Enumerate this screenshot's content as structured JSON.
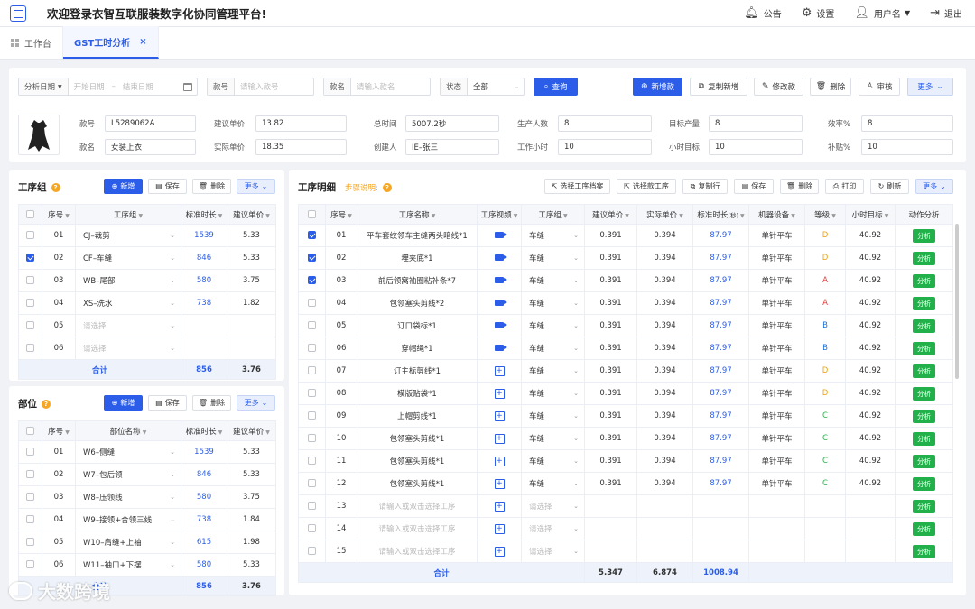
{
  "header": {
    "title": "欢迎登录衣智互联服装数字化协同管理平台!",
    "items": [
      {
        "icon": "bell-icon",
        "label": "公告"
      },
      {
        "icon": "gear-icon",
        "label": "设置"
      },
      {
        "icon": "user-icon",
        "label": "用户名"
      },
      {
        "icon": "logout-icon",
        "label": "退出"
      }
    ]
  },
  "tabs": [
    {
      "label": "工作台"
    },
    {
      "label": "GST工时分析",
      "close": "×"
    }
  ],
  "filters": {
    "date_label": "分析日期",
    "start_ph": "开始日期",
    "sep": "–",
    "end_ph": "结束日期",
    "no_label": "款号",
    "no_ph": "请输入款号",
    "name_label": "款名",
    "name_ph": "请输入款名",
    "status_label": "状态",
    "status_value": "全部",
    "query": "查询"
  },
  "actions": [
    "新增款",
    "复制新增",
    "修改款",
    "删除",
    "审核",
    "更多"
  ],
  "info": [
    {
      "label": "款号",
      "value": "L5289062A"
    },
    {
      "label": "建议单价",
      "value": "13.82"
    },
    {
      "label": "总时间",
      "value": "5007.2秒"
    },
    {
      "label": "生产人数",
      "value": "8"
    },
    {
      "label": "目标产量",
      "value": "8"
    },
    {
      "label": "效率%",
      "value": "8"
    },
    {
      "label": "款名",
      "value": "女装上衣"
    },
    {
      "label": "实际单价",
      "value": "18.35"
    },
    {
      "label": "创建人",
      "value": "IE–张三"
    },
    {
      "label": "工作小时",
      "value": "10"
    },
    {
      "label": "小时目标",
      "value": "10"
    },
    {
      "label": "补贴%",
      "value": "10"
    }
  ],
  "process_group": {
    "title": "工序组",
    "buttons": [
      "新增",
      "保存",
      "删除",
      "更多"
    ],
    "headers": [
      "序号",
      "工序组",
      "标准时长",
      "建议单价"
    ],
    "rows": [
      {
        "checked": false,
        "no": "01",
        "group": "CJ–裁剪",
        "time": "1539",
        "price": "5.33"
      },
      {
        "checked": true,
        "no": "02",
        "group": "CF–车缝",
        "time": "846",
        "price": "5.33"
      },
      {
        "checked": false,
        "no": "03",
        "group": "WB–尾部",
        "time": "580",
        "price": "3.75"
      },
      {
        "checked": false,
        "no": "04",
        "group": "XS–洗水",
        "time": "738",
        "price": "1.82"
      },
      {
        "checked": false,
        "no": "05",
        "group": "请选择",
        "time": "",
        "price": ""
      },
      {
        "checked": false,
        "no": "06",
        "group": "请选择",
        "time": "",
        "price": ""
      }
    ],
    "total": {
      "label": "合计",
      "time": "856",
      "price": "3.76"
    }
  },
  "part": {
    "title": "部位",
    "buttons": [
      "新增",
      "保存",
      "删除",
      "更多"
    ],
    "headers": [
      "序号",
      "部位名称",
      "标准时长",
      "建议单价"
    ],
    "rows": [
      {
        "no": "01",
        "name": "W6–侧缝",
        "time": "1539",
        "price": "5.33"
      },
      {
        "no": "02",
        "name": "W7–包后领",
        "time": "846",
        "price": "5.33"
      },
      {
        "no": "03",
        "name": "W8–压领线",
        "time": "580",
        "price": "3.75"
      },
      {
        "no": "04",
        "name": "W9–接领+合领三线",
        "time": "738",
        "price": "1.84"
      },
      {
        "no": "05",
        "name": "W10–肩缝+上袖",
        "time": "615",
        "price": "1.98"
      },
      {
        "no": "06",
        "name": "W11–袖口+下摆",
        "time": "580",
        "price": "5.33"
      }
    ],
    "total": {
      "label": "合计",
      "time": "856",
      "price": "3.76"
    }
  },
  "detail": {
    "title": "工序明细",
    "note": "步骤说明:",
    "buttons": [
      "选择工序档案",
      "选择款工序",
      "复制行",
      "保存",
      "删除",
      "打印",
      "刷新",
      "更多"
    ],
    "headers": [
      "序号",
      "工序名称",
      "工序视频",
      "工序组",
      "建议单价",
      "实际单价",
      "标准时长",
      "机器设备",
      "等级",
      "小时目标",
      "动作分析"
    ],
    "time_unit": "(秒)",
    "rows": [
      {
        "checked": true,
        "no": "01",
        "name": "平车套纹领车主缝两头暗线*1",
        "video": "video",
        "group": "车缝",
        "sp": "0.391",
        "ap": "0.394",
        "time": "87.97",
        "machine": "单针平车",
        "grade": "D",
        "target": "40.92"
      },
      {
        "checked": true,
        "no": "02",
        "name": "埋夹底*1",
        "video": "video",
        "group": "车缝",
        "sp": "0.391",
        "ap": "0.394",
        "time": "87.97",
        "machine": "单针平车",
        "grade": "D",
        "target": "40.92"
      },
      {
        "checked": true,
        "no": "03",
        "name": "前后领窝袖圈粘补条*7",
        "video": "video",
        "group": "车缝",
        "sp": "0.391",
        "ap": "0.394",
        "time": "87.97",
        "machine": "单针平车",
        "grade": "A",
        "target": "40.92"
      },
      {
        "checked": false,
        "no": "04",
        "name": "包领塞头剪线*2",
        "video": "video",
        "group": "车缝",
        "sp": "0.391",
        "ap": "0.394",
        "time": "87.97",
        "machine": "单针平车",
        "grade": "A",
        "target": "40.92"
      },
      {
        "checked": false,
        "no": "05",
        "name": "订口袋标*1",
        "video": "video",
        "group": "车缝",
        "sp": "0.391",
        "ap": "0.394",
        "time": "87.97",
        "machine": "单针平车",
        "grade": "B",
        "target": "40.92"
      },
      {
        "checked": false,
        "no": "06",
        "name": "穿帽绳*1",
        "video": "video",
        "group": "车缝",
        "sp": "0.391",
        "ap": "0.394",
        "time": "87.97",
        "machine": "单针平车",
        "grade": "B",
        "target": "40.92"
      },
      {
        "checked": false,
        "no": "07",
        "name": "订主标剪线*1",
        "video": "add",
        "group": "车缝",
        "sp": "0.391",
        "ap": "0.394",
        "time": "87.97",
        "machine": "单针平车",
        "grade": "D",
        "target": "40.92"
      },
      {
        "checked": false,
        "no": "08",
        "name": "模版贴袋*1",
        "video": "add",
        "group": "车缝",
        "sp": "0.391",
        "ap": "0.394",
        "time": "87.97",
        "machine": "单针平车",
        "grade": "D",
        "target": "40.92"
      },
      {
        "checked": false,
        "no": "09",
        "name": "上帽剪线*1",
        "video": "add",
        "group": "车缝",
        "sp": "0.391",
        "ap": "0.394",
        "time": "87.97",
        "machine": "单针平车",
        "grade": "C",
        "target": "40.92"
      },
      {
        "checked": false,
        "no": "10",
        "name": "包领塞头剪线*1",
        "video": "add",
        "group": "车缝",
        "sp": "0.391",
        "ap": "0.394",
        "time": "87.97",
        "machine": "单针平车",
        "grade": "C",
        "target": "40.92"
      },
      {
        "checked": false,
        "no": "11",
        "name": "包领塞头剪线*1",
        "video": "add",
        "group": "车缝",
        "sp": "0.391",
        "ap": "0.394",
        "time": "87.97",
        "machine": "单针平车",
        "grade": "C",
        "target": "40.92"
      },
      {
        "checked": false,
        "no": "12",
        "name": "包领塞头剪线*1",
        "video": "add",
        "group": "车缝",
        "sp": "0.391",
        "ap": "0.394",
        "time": "87.97",
        "machine": "单针平车",
        "grade": "C",
        "target": "40.92"
      },
      {
        "checked": false,
        "no": "13",
        "name": "请输入或双击选择工序",
        "video": "add",
        "group": "请选择",
        "placeholder": true
      },
      {
        "checked": false,
        "no": "14",
        "name": "请输入或双击选择工序",
        "video": "add",
        "group": "请选择",
        "placeholder": true
      },
      {
        "checked": false,
        "no": "15",
        "name": "请输入或双击选择工序",
        "video": "add",
        "group": "请选择",
        "placeholder": true
      }
    ],
    "analysis_label": "分析",
    "total": {
      "label": "合计",
      "sp": "5.347",
      "ap": "6.874",
      "time": "1008.94"
    }
  },
  "watermark": "大数跨境",
  "colors": {
    "primary": "#2b5de8",
    "analysis": "#22b04a",
    "gradeA": "#e53935",
    "gradeB": "#1e6fd9",
    "gradeC": "#2bb14a",
    "gradeD": "#e8a21a"
  }
}
